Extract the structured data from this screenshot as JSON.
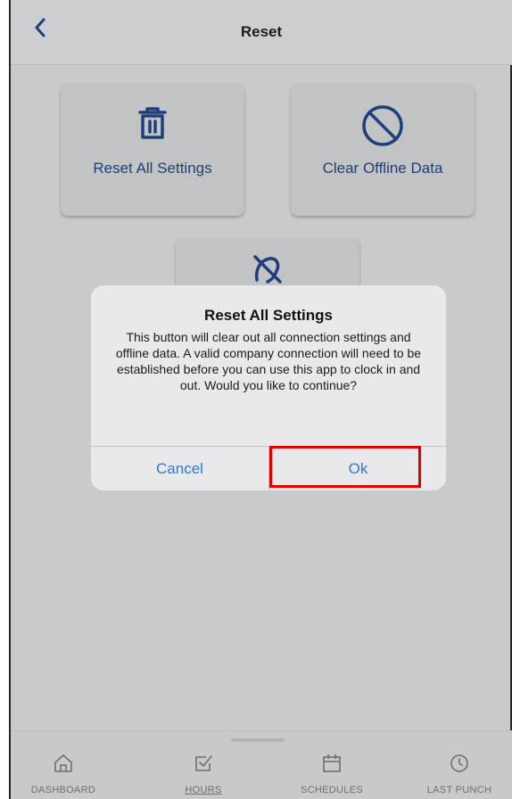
{
  "header": {
    "back_icon": "chevron-left-icon",
    "title": "Reset"
  },
  "tiles": [
    {
      "label": "Reset All Settings",
      "icon": "trash-icon"
    },
    {
      "label": "Clear Offline Data",
      "icon": "prohibited-icon"
    },
    {
      "label": "",
      "icon": "hand-slash-icon"
    }
  ],
  "dialog": {
    "title": "Reset All Settings",
    "message": "This button will clear out all connection settings and offline data. A valid company connection will need to be established before you can use this app to clock in and out. Would you like to continue?",
    "cancel_label": "Cancel",
    "ok_label": "Ok"
  },
  "tabbar": {
    "items": [
      {
        "label": "DASHBOARD",
        "icon": "home-icon"
      },
      {
        "label": "HOURS",
        "icon": "checkbox-icon"
      },
      {
        "label": "SCHEDULES",
        "icon": "calendar-icon"
      },
      {
        "label": "LAST PUNCH",
        "icon": "clock-icon"
      }
    ]
  },
  "colors": {
    "accent": "#1f3f7a",
    "dialog_button": "#3478c5",
    "highlight": "#e00000"
  }
}
